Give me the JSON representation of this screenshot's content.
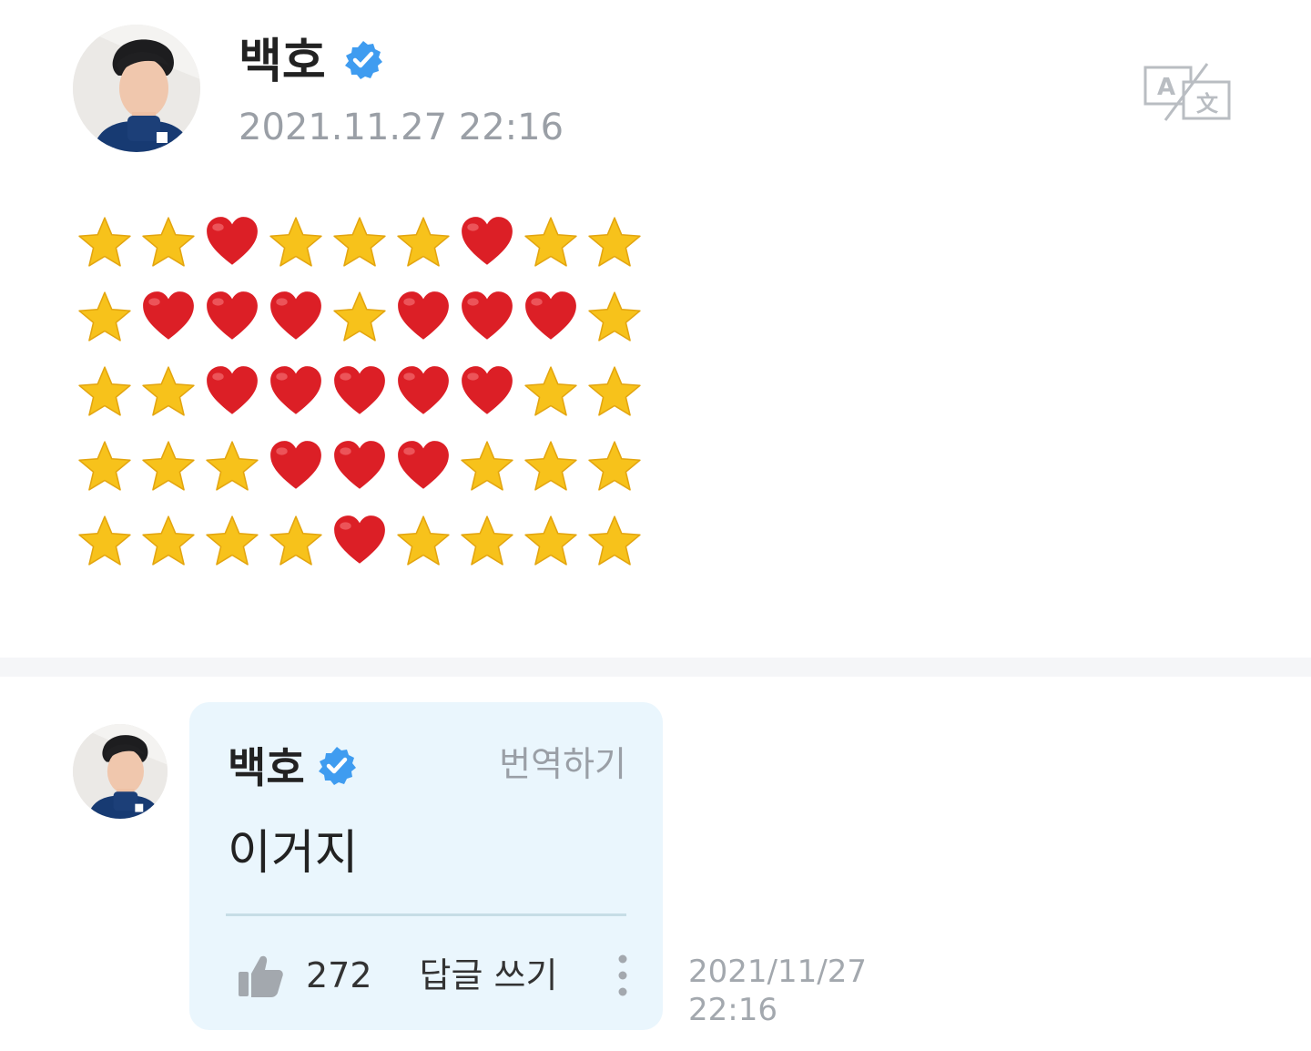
{
  "post": {
    "author_name": "백호",
    "verified": true,
    "date": "2021.11.27 22:16",
    "translate_icon": "translate-icon",
    "emoji_grid": [
      [
        "star",
        "star",
        "heart",
        "star",
        "star",
        "star",
        "heart",
        "star",
        "star"
      ],
      [
        "star",
        "heart",
        "heart",
        "heart",
        "star",
        "heart",
        "heart",
        "heart",
        "star"
      ],
      [
        "star",
        "star",
        "heart",
        "heart",
        "heart",
        "heart",
        "heart",
        "star",
        "star"
      ],
      [
        "star",
        "star",
        "star",
        "heart",
        "heart",
        "heart",
        "star",
        "star",
        "star"
      ],
      [
        "star",
        "star",
        "star",
        "star",
        "heart",
        "star",
        "star",
        "star",
        "star"
      ]
    ]
  },
  "comment": {
    "author_name": "백호",
    "verified": true,
    "translate_label": "번역하기",
    "text": "이거지",
    "like_count": "272",
    "reply_label": "답글 쓰기",
    "date_line1": "2021/11/27",
    "date_line2": "22:16"
  },
  "colors": {
    "verified_blue": "#3f9cf0",
    "bubble_bg": "#eaf6fd",
    "meta_gray": "#9a9fa6",
    "star_yellow": "#f7c21b",
    "heart_red": "#dc1f26"
  }
}
